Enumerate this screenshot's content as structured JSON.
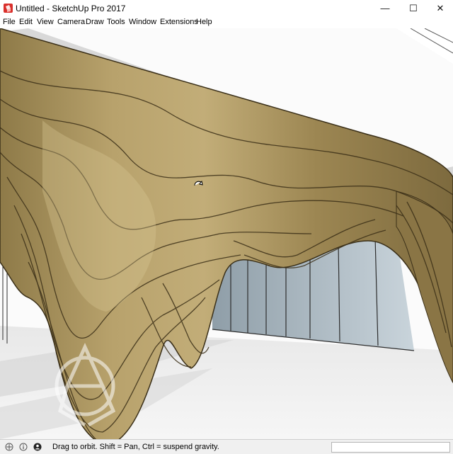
{
  "window": {
    "title": "Untitled - SketchUp Pro 2017",
    "app_icon": "sketchup-icon",
    "buttons": {
      "minimize": "—",
      "maximize": "☐",
      "close": "✕"
    }
  },
  "menu": [
    "File",
    "Edit",
    "View",
    "Camera",
    "Draw",
    "Tools",
    "Window",
    "Extensions",
    "Help"
  ],
  "status": {
    "message": "Drag to orbit. Shift = Pan, Ctrl = suspend gravity.",
    "icons": [
      "geolocation-icon",
      "credit-info-icon",
      "user-icon"
    ],
    "measurements_value": ""
  },
  "colors": {
    "wood_light": "#b49d66",
    "wood_dark": "#6e5a33",
    "floor": "#ececec",
    "glass": "#a9b8c2"
  }
}
